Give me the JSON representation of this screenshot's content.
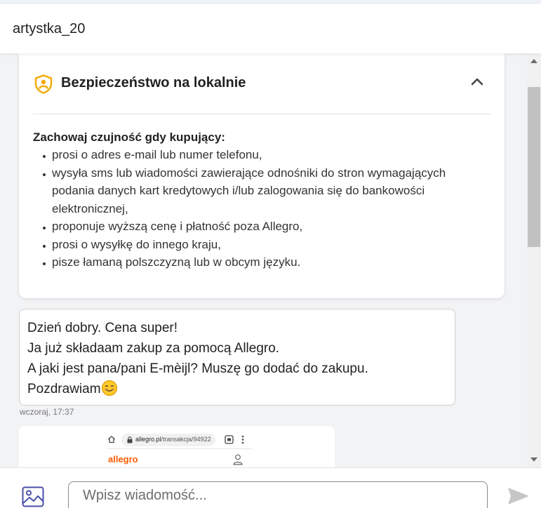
{
  "header": {
    "title": "artystka_20"
  },
  "safety": {
    "title": "Bezpieczeństwo na lokalnie",
    "heading": "Zachowaj czujność gdy kupujący:",
    "items": [
      "prosi o adres e-mail lub numer telefonu,",
      "wysyła sms lub wiadomości zawierające odnośniki do stron wymagających podania danych kart kredytowych i/lub zalogowania się do bankowości elektronicznej,",
      "proponuje wyższą cenę i płatność poza Allegro,",
      "prosi o wysyłkę do innego kraju,",
      "pisze łamaną polszczyzną lub w obcym języku."
    ]
  },
  "message": {
    "lines": [
      "Dzień dobry. Cena super!",
      "Ja już składaam zakup za pomocą Allegro.",
      "A jaki jest pana/pani E-mèijl? Muszę go dodać do zakupu.",
      "Pozdrawiam"
    ],
    "time": "wczoraj, 17:37"
  },
  "attachment": {
    "url_domain": "allegro.pl",
    "url_path": "/transakcja/94922",
    "logo": "allegro"
  },
  "composer": {
    "placeholder": "Wpisz wiadomość..."
  },
  "icons": {
    "shield": "shield-user-icon",
    "collapse": "chevron-up-icon",
    "emoji": "smiling-face-icon",
    "image": "image-icon",
    "send": "send-icon"
  },
  "colors": {
    "shield_accent": "#f2a900",
    "allegro_orange": "#ff5a00",
    "image_icon": "#4a4fa8",
    "send_icon": "#c6c6c6"
  }
}
